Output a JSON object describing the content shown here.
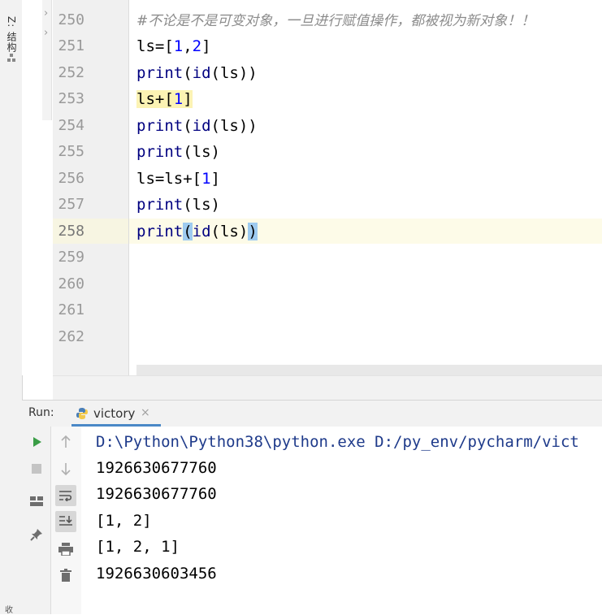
{
  "left_strip": {
    "structure_label": "Z: 结构",
    "bottom_label": "收"
  },
  "editor": {
    "lines": [
      {
        "num": "250",
        "code": "#不论是不是可变对象，一旦进行赋值操作，都被视为新对象！！"
      },
      {
        "num": "251",
        "code": "ls=[1,2]"
      },
      {
        "num": "252",
        "code": "print(id(ls))"
      },
      {
        "num": "253",
        "code": "ls+[1]"
      },
      {
        "num": "254",
        "code": "print(id(ls))"
      },
      {
        "num": "255",
        "code": "print(ls)"
      },
      {
        "num": "256",
        "code": "ls=ls+[1]"
      },
      {
        "num": "257",
        "code": "print(ls)"
      },
      {
        "num": "258",
        "code": "print(id(ls))"
      },
      {
        "num": "259",
        "code": ""
      },
      {
        "num": "260",
        "code": ""
      },
      {
        "num": "261",
        "code": ""
      },
      {
        "num": "262",
        "code": ""
      }
    ],
    "current_line": "258"
  },
  "run_panel": {
    "label": "Run:",
    "tab_label": "victory",
    "tab_close": "×",
    "output": [
      "D:\\Python\\Python38\\python.exe D:/py_env/pycharm/vict",
      "1926630677760",
      "1926630677760",
      "[1, 2]",
      "[1, 2, 1]",
      "1926630603456"
    ]
  },
  "toolbar_icons": [
    "run-icon",
    "stop-icon",
    "layout-icon",
    "pin-icon",
    "up-arrow-icon",
    "down-arrow-icon",
    "soft-wrap-icon",
    "scroll-to-end-icon",
    "print-icon",
    "trash-icon"
  ],
  "colors": {
    "keyword": "#000080",
    "number": "#0000ff",
    "comment": "#8c8c8c",
    "run_green": "#3a9d46",
    "tab_underline": "#4a88c7"
  }
}
